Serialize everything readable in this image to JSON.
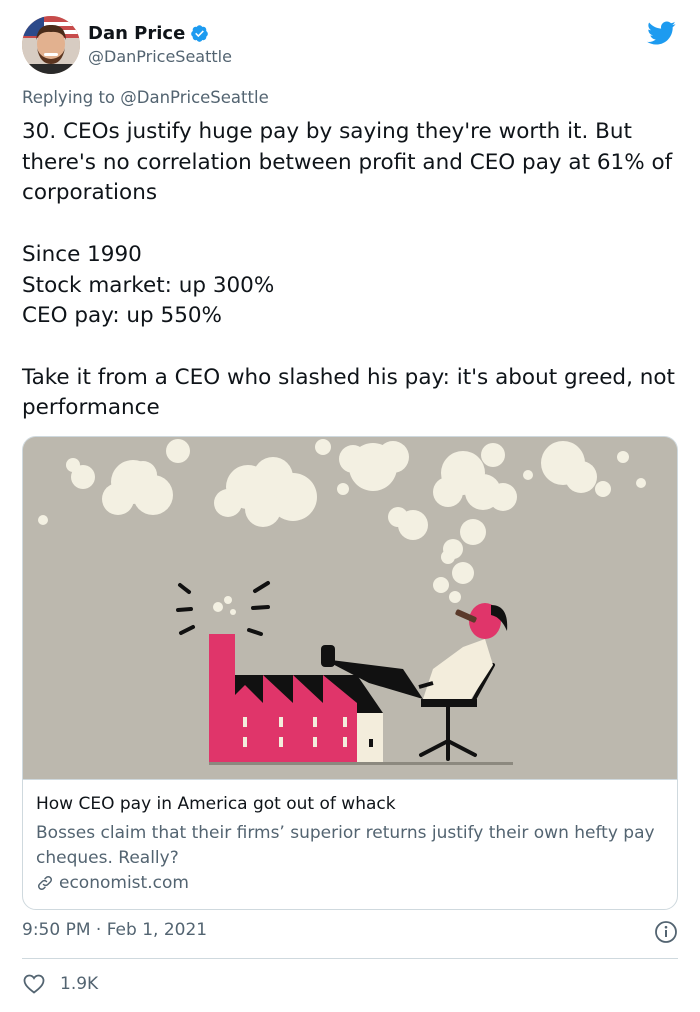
{
  "author": {
    "display_name": "Dan Price",
    "handle": "@DanPriceSeattle",
    "verified": true
  },
  "reply": {
    "prefix": "Replying to",
    "handle": "@DanPriceSeattle"
  },
  "tweet": {
    "text": "30. CEOs justify huge pay by saying they're worth it. But there's no correlation between profit and CEO pay at 61% of corporations\n\nSince 1990\nStock market: up 300%\nCEO pay: up 550%\n\nTake it from a CEO who slashed his pay: it's about greed, not performance"
  },
  "card": {
    "title": "How CEO pay in America got out of whack",
    "description": "Bosses claim that their firms’ superior returns justify their own hefty pay cheques. Really?",
    "domain": "economist.com"
  },
  "meta": {
    "timestamp": "9:50 PM · Feb 1, 2021"
  },
  "engagement": {
    "likes": "1.9K"
  },
  "colors": {
    "accent": "#1d9bf0",
    "text": "#0f1419",
    "secondary": "#536471",
    "border": "#cfd9de",
    "illustration_bg": "#bcb8ae",
    "factory_pink": "#e0356a"
  },
  "icons": [
    "verified-badge-icon",
    "twitter-bird-icon",
    "link-icon",
    "info-icon",
    "heart-icon"
  ]
}
